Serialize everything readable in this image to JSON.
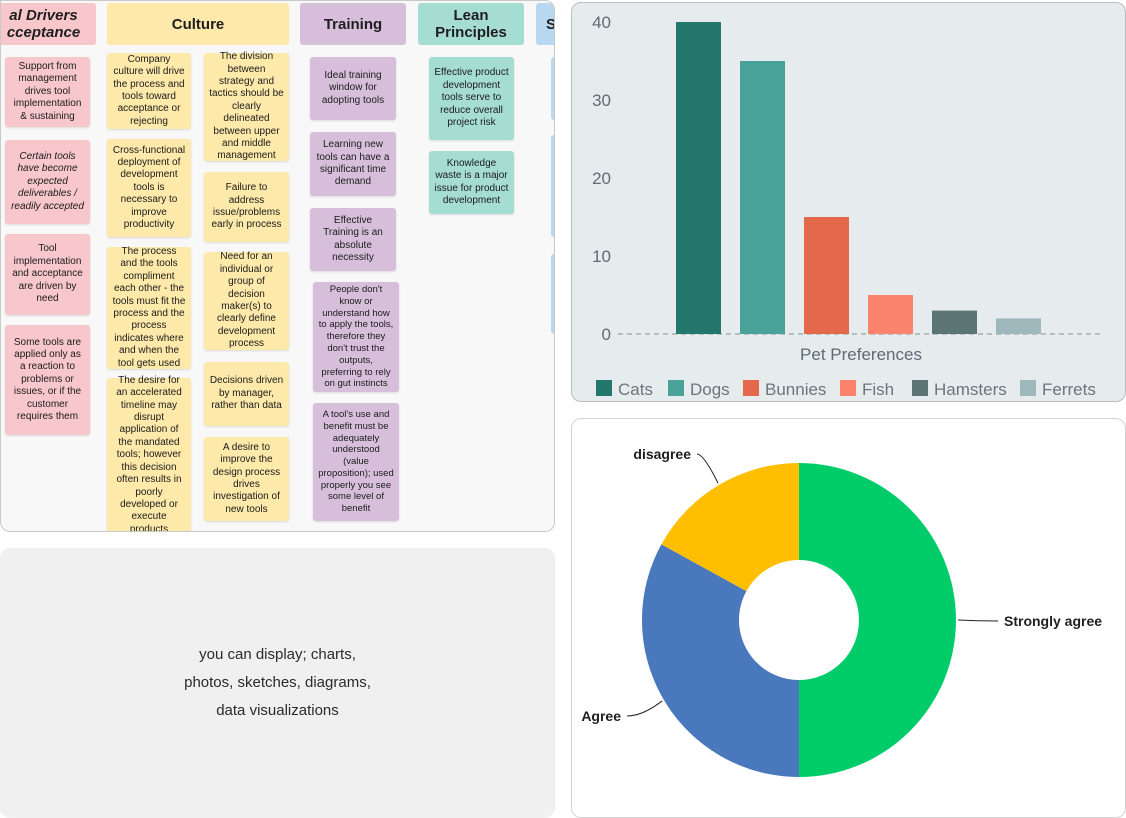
{
  "board": {
    "headers": [
      {
        "label": "al Drivers\ncceptance"
      },
      {
        "label": "Culture"
      },
      {
        "label": "Training"
      },
      {
        "label": "Lean\nPrinciples"
      },
      {
        "label": "S"
      }
    ],
    "notes": {
      "drivers": [
        "Support from management drives tool implementation & sustaining",
        "Certain tools have become expected deliverables / readily accepted",
        "Tool implementation and acceptance are driven by need",
        "Some tools are applied only as a reaction to problems or issues, or if the customer requires them"
      ],
      "culture_left": [
        "Company culture will drive the process and tools toward acceptance or rejecting",
        "Cross-functional deployment of development tools is necessary to improve productivity",
        "The process and the tools compliment each other - the tools must fit the process and the process indicates where and when the tool gets used",
        "The desire for an accelerated timeline may disrupt application of the mandated tools; however this decision often results in poorly developed or execute products"
      ],
      "culture_right": [
        "The division between strategy and tactics should be clearly delineated between upper and middle management",
        "Failure to address issue/problems early in process",
        "Need for an individual or group of decision maker(s) to clearly define development process",
        "Decisions driven by manager, rather than data",
        "A desire to improve the design process drives investigation of new tools"
      ],
      "training": [
        "Ideal training window for adopting tools",
        "Learning new tools can have a significant time demand",
        "Effective Training is an absolute necessity",
        "People don't know or understand how to apply the tools, therefore they don't trust the outputs, preferring to rely on gut instincts",
        "A tool's use and benefit must be adequately understood (value proposition); used properly you see some level of benefit"
      ],
      "lean": [
        "Effective product development tools serve to reduce overall project risk",
        "Knowledge waste is a major issue for product development"
      ]
    }
  },
  "textcard": {
    "lines": [
      "you can display; charts,",
      "photos, sketches, diagrams,",
      "data visualizations"
    ]
  },
  "chart_data": [
    {
      "type": "bar",
      "categories": [
        "Cats",
        "Dogs",
        "Bunnies",
        "Fish",
        "Hamsters",
        "Ferrets"
      ],
      "values": [
        40,
        35,
        15,
        5,
        3,
        2
      ],
      "colors": [
        "#23786b",
        "#48a298",
        "#e4694c",
        "#fb826b",
        "#5d7475",
        "#9fb8bb"
      ],
      "xlabel": "Pet Preferences",
      "ylabel": "",
      "yticks": [
        "0",
        "10",
        "20",
        "30",
        "40"
      ],
      "ylim": [
        0,
        40
      ],
      "legend": "bottom",
      "grid": false
    },
    {
      "type": "pie",
      "categories": [
        "Strongly agree",
        "Agree",
        "disagree"
      ],
      "values": [
        50,
        33,
        17
      ],
      "colors": [
        "#00cc6a",
        "#4a78bd",
        "#ffbf00"
      ],
      "donut": true
    }
  ]
}
